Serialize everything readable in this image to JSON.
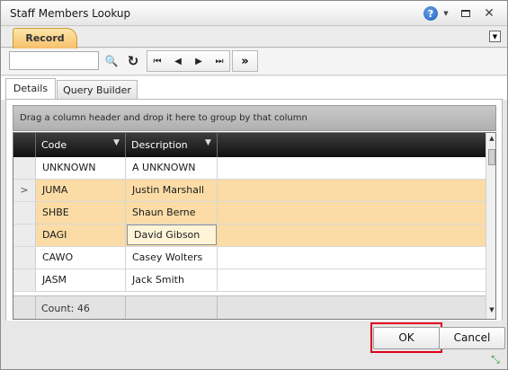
{
  "window": {
    "title": "Staff Members Lookup"
  },
  "titlebar": {
    "help_icon": "?",
    "dropdown_icon": "▼",
    "close_icon": "✕"
  },
  "ribbon": {
    "tab_label": "Record",
    "tab_color": "#f7c06a",
    "dropdown_icon": "▼"
  },
  "toolbar": {
    "search_value": "",
    "search_icon": "🔍",
    "refresh_icon": "↻",
    "first_icon": "⏮",
    "prev_icon": "◀",
    "next_icon": "▶",
    "last_icon": "⏭",
    "more_icon": "»"
  },
  "tabs": [
    {
      "label": "Details"
    },
    {
      "label": "Query Builder"
    }
  ],
  "grid": {
    "group_prompt": "Drag a column header and drop it here to group by that column",
    "columns": [
      "Code",
      "Description"
    ],
    "rows": [
      {
        "indicator": "",
        "code": "UNKNOWN",
        "description": "A UNKNOWN"
      },
      {
        "indicator": ">",
        "code": "JUMA",
        "description": "Justin Marshall"
      },
      {
        "indicator": "",
        "code": "SHBE",
        "description": "Shaun Berne"
      },
      {
        "indicator": "",
        "code": "DAGI",
        "description": "David Gibson"
      },
      {
        "indicator": "",
        "code": "CAWO",
        "description": "Casey Wolters"
      },
      {
        "indicator": "",
        "code": "JASM",
        "description": "Jack Smith"
      }
    ],
    "selection_color": "#fbdca6",
    "count_label": "Count: 46"
  },
  "buttons": {
    "ok_label": "OK",
    "cancel_label": "Cancel",
    "highlight_color": "#e0001b"
  }
}
